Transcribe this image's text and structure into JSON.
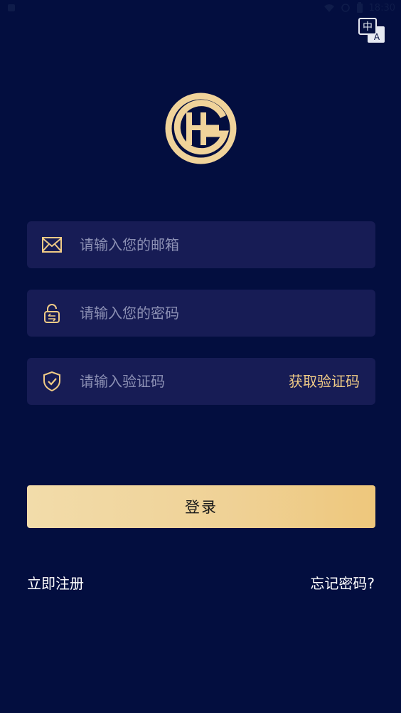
{
  "status_bar": {
    "time": "18:30",
    "icons": [
      "notification-icon",
      "wifi-icon",
      "alarm-icon",
      "battery-icon"
    ]
  },
  "language_button": {
    "icon": "translate-icon",
    "glyph_top": "中",
    "glyph_bottom": "A"
  },
  "logo": {
    "text": "HG",
    "color": "#f0d39a"
  },
  "form": {
    "email": {
      "icon": "mail-icon",
      "placeholder": "请输入您的邮箱",
      "value": ""
    },
    "password": {
      "icon": "lock-icon",
      "placeholder": "请输入您的密码",
      "value": ""
    },
    "code": {
      "icon": "shield-check-icon",
      "placeholder": "请输入验证码",
      "value": "",
      "get_code_label": "获取验证码"
    }
  },
  "login_button": {
    "label": "登录"
  },
  "links": {
    "register": "立即注册",
    "forgot_password": "忘记密码?"
  },
  "colors": {
    "background": "#030e3f",
    "field_background": "#171c55",
    "accent_gold": "#f0cb86",
    "placeholder": "#8c90b4"
  }
}
